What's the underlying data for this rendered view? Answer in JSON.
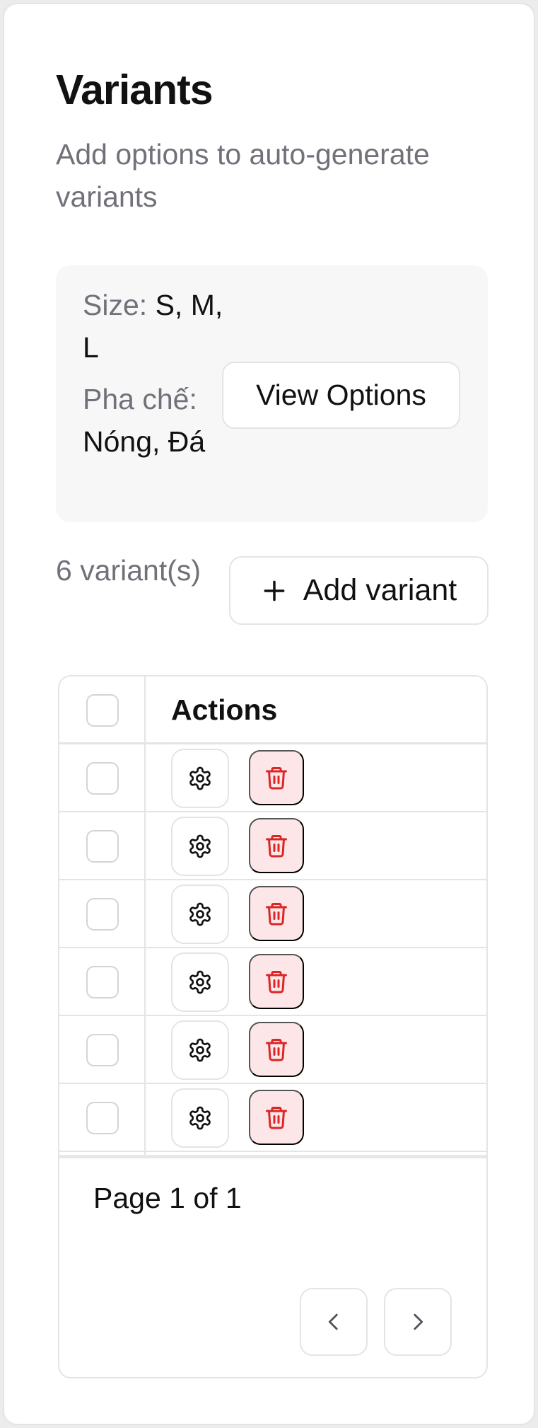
{
  "header": {
    "title": "Variants",
    "subtitle": "Add options to auto-generate variants"
  },
  "options": {
    "groups": [
      {
        "name": "Size:",
        "values": "S, M, L"
      },
      {
        "name": "Pha chế:",
        "values": "Nóng, Đá"
      }
    ],
    "view_button_label": "View Options"
  },
  "variants": {
    "count_label": "6 variant(s)",
    "add_button_label": "Add variant"
  },
  "table": {
    "columns": [
      "Actions"
    ],
    "rows": [
      {},
      {},
      {},
      {},
      {},
      {}
    ],
    "pagination": {
      "label": "Page 1 of 1"
    }
  },
  "colors": {
    "danger": "#dc2626",
    "danger_bg": "#fde6e7",
    "border": "#e4e4e7",
    "muted_text": "#71717a"
  },
  "icons": {
    "add": "plus-icon",
    "settings": "gear-icon",
    "delete": "trash-icon",
    "prev": "chevron-left-icon",
    "next": "chevron-right-icon"
  }
}
